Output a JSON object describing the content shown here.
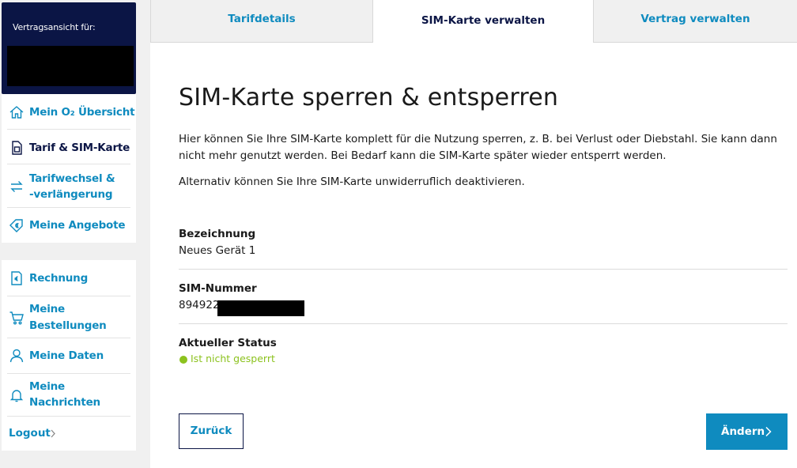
{
  "sidebar": {
    "contract_label": "Vertragsansicht für:",
    "nav_primary": [
      {
        "label": "Mein O₂ Übersicht",
        "icon": "home-icon"
      },
      {
        "label": "Tarif & SIM-Karte",
        "icon": "sim-card-icon",
        "active": true
      },
      {
        "label_line1": "Tarifwechsel &",
        "label_line2": "-verlängerung",
        "icon": "swap-arrows-icon"
      },
      {
        "label": "Meine Angebote",
        "icon": "offer-tag-icon"
      }
    ],
    "nav_secondary": [
      {
        "label": "Rechnung",
        "icon": "invoice-icon"
      },
      {
        "label_line1": "Meine",
        "label_line2": "Bestellungen",
        "icon": "cart-icon"
      },
      {
        "label": "Meine Daten",
        "icon": "user-icon"
      },
      {
        "label_line1": "Meine",
        "label_line2": "Nachrichten",
        "icon": "bell-icon"
      }
    ],
    "logout_label": "Logout"
  },
  "tabs": [
    {
      "label": "Tarifdetails"
    },
    {
      "label": "SIM-Karte verwalten",
      "active": true
    },
    {
      "label": "Vertrag verwalten"
    }
  ],
  "main": {
    "title": "SIM-Karte sperren & entsperren",
    "intro": "Hier können Sie Ihre SIM-Karte komplett für die Nutzung sperren, z. B. bei Verlust oder Diebstahl. Sie kann dann nicht mehr genutzt werden. Bei Bedarf kann die SIM-Karte später wieder entsperrt werden.",
    "alt_text": "Alternativ können Sie Ihre SIM-Karte unwiderruflich deaktivieren.",
    "fields": {
      "designation_label": "Bezeichnung",
      "designation_value": "Neues Gerät 1",
      "sim_label": "SIM-Nummer",
      "sim_value_prefix": "894922",
      "status_label": "Aktueller Status",
      "status_value": "Ist nicht gesperrt"
    },
    "back_label": "Zurück",
    "change_label": "Ändern"
  },
  "colors": {
    "brand_navy": "#0b1545",
    "link_blue": "#0f8bbf",
    "status_green": "#8cc21e"
  }
}
